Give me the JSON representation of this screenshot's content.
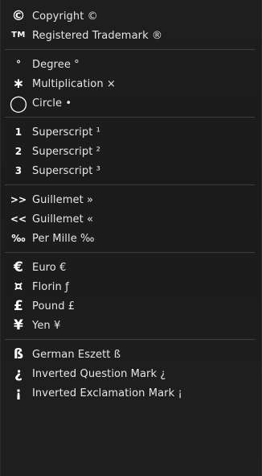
{
  "menu": {
    "groups": [
      {
        "items": [
          {
            "glyph": "©",
            "label": "Copyright ©",
            "name": "copyright"
          },
          {
            "glyph": "TM",
            "label": "Registered Trademark ®",
            "name": "registered-trademark"
          }
        ]
      },
      {
        "items": [
          {
            "glyph": "°",
            "label": "Degree °",
            "name": "degree"
          },
          {
            "glyph": "∗",
            "label": "Multiplication ×",
            "name": "multiplication"
          },
          {
            "glyph": "◯",
            "label": "Circle •",
            "name": "circle"
          }
        ]
      },
      {
        "items": [
          {
            "glyph": "1",
            "label": "Superscript ¹",
            "name": "superscript-1"
          },
          {
            "glyph": "2",
            "label": "Superscript ²",
            "name": "superscript-2"
          },
          {
            "glyph": "3",
            "label": "Superscript ³",
            "name": "superscript-3"
          }
        ]
      },
      {
        "items": [
          {
            "glyph": ">>",
            "label": "Guillemet »",
            "name": "guillemet-right"
          },
          {
            "glyph": "<<",
            "label": "Guillemet «",
            "name": "guillemet-left"
          },
          {
            "glyph": "‰",
            "label": "Per Mille ‰",
            "name": "per-mille"
          }
        ]
      },
      {
        "items": [
          {
            "glyph": "€",
            "label": "Euro €",
            "name": "euro"
          },
          {
            "glyph": "¤",
            "label": "Florin ƒ",
            "name": "florin"
          },
          {
            "glyph": "£",
            "label": "Pound £",
            "name": "pound"
          },
          {
            "glyph": "¥",
            "label": "Yen ¥",
            "name": "yen"
          }
        ]
      },
      {
        "items": [
          {
            "glyph": "ß",
            "label": "German Eszett ß",
            "name": "german-eszett"
          },
          {
            "glyph": "¿",
            "label": "Inverted Question Mark ¿",
            "name": "inverted-question-mark"
          },
          {
            "glyph": "¡",
            "label": "Inverted Exclamation Mark ¡",
            "name": "inverted-exclamation-mark"
          }
        ]
      }
    ]
  }
}
